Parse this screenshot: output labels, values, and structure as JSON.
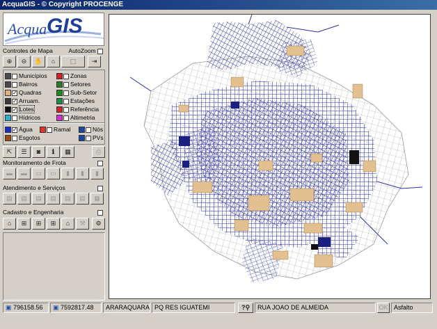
{
  "window": {
    "title": "AcquaGIS - © Copyright PROCENGE"
  },
  "logo": {
    "acqua": "Acqua",
    "gis": "GIS"
  },
  "controls": {
    "label": "Controles de Mapa",
    "autozoom_label": "AutoZoom"
  },
  "layers": [
    {
      "label": "Municípios",
      "color": "#4a4a4a",
      "checked": false
    },
    {
      "label": "Zonas",
      "color": "#d42020",
      "checked": false
    },
    {
      "label": "Bairros",
      "color": "#4a4a4a",
      "checked": false
    },
    {
      "label": "Setores",
      "color": "#2a7a2a",
      "checked": false
    },
    {
      "label": "Quadras",
      "color": "#e0b080",
      "checked": true
    },
    {
      "label": "Sub-Setor",
      "color": "#1e8a1e",
      "checked": false
    },
    {
      "label": "Arruam.",
      "color": "#3a3a3a",
      "checked": true
    },
    {
      "label": "Estações",
      "color": "#1e8a4a",
      "checked": false
    },
    {
      "label": "Lotes",
      "color": "#111111",
      "checked": true
    },
    {
      "label": "Referência",
      "color": "#d42020",
      "checked": false
    },
    {
      "label": "Hídricos",
      "color": "#2fb0d0",
      "checked": false
    },
    {
      "label": "Altimetria",
      "color": "#d430d4",
      "checked": false
    },
    {
      "label": "Água",
      "color": "#1a2ad0",
      "checked": true
    },
    {
      "label": "Ramal",
      "color": "#e03030",
      "checked": false
    },
    {
      "label": "Nós",
      "color": "#1a4aa0",
      "checked": false
    },
    {
      "label": "Esgotos",
      "color": "#a04a10",
      "checked": false
    },
    {
      "label": "PVs",
      "color": "#1a4aa0",
      "checked": false
    }
  ],
  "sections": {
    "frota": "Monitoramento de Frota",
    "atendimento": "Atendimento e Serviços",
    "cadastro": "Cadastro e Engenharia"
  },
  "status": {
    "x_coord": "796158.56",
    "y_coord": "7592817.48",
    "city": "ARARAQUARA",
    "neighborhood": "PQ RES IGUATEMI",
    "street": "RUA JOAO DE ALMEIDA",
    "ok_label": "OK",
    "surface": "Asfalto"
  },
  "colors": {
    "map_network": "#2b2fa8",
    "map_block": "#e3c08f",
    "map_gray": "#8a8a8a"
  }
}
